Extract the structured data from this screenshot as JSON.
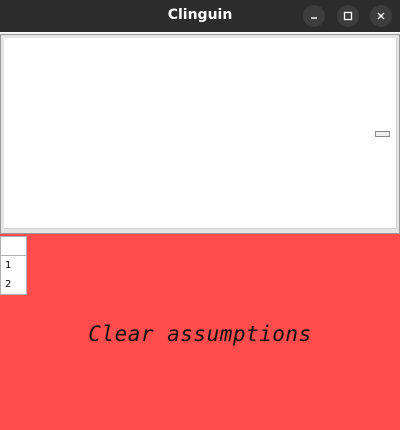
{
  "window": {
    "title": "Clinguin",
    "controls": [
      "minimize-icon",
      "maximize-icon",
      "close-icon"
    ]
  },
  "assumptions": {
    "items": [
      "1",
      "2"
    ]
  },
  "action": {
    "label": "Clear assumptions",
    "background_color": "#ff4d4d"
  },
  "colors": {
    "titlebar": "#2c2c2c",
    "panel": "#ffffff"
  }
}
